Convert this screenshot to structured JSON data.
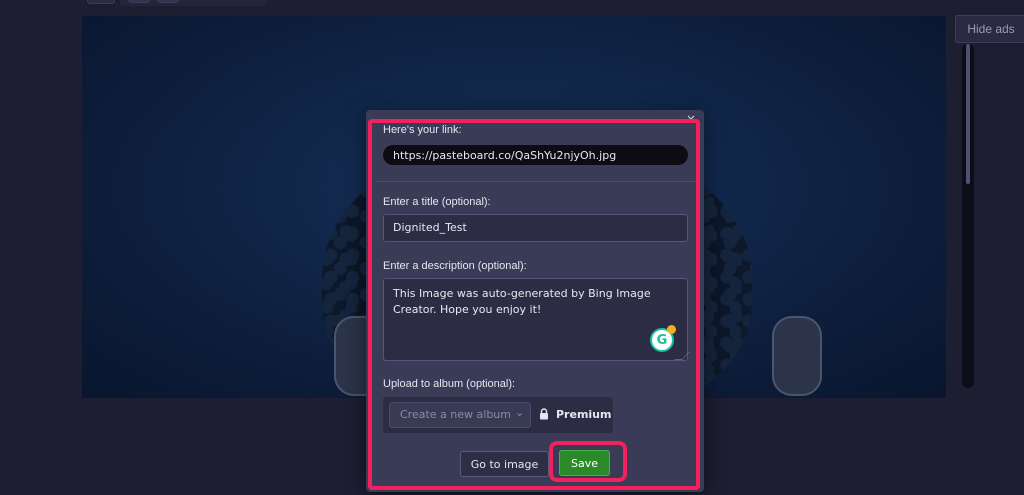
{
  "header": {
    "hide_ads_label": "Hide ads"
  },
  "dialog": {
    "link_label": "Here's your link:",
    "link_value": "https://pasteboard.co/QaShYu2njyOh.jpg",
    "title_label": "Enter a title (optional):",
    "title_value": "Dignited_Test",
    "description_label": "Enter a description (optional):",
    "description_value": "This Image was auto-generated by Bing Image Creator. Hope you enjoy it!",
    "album_label": "Upload to album (optional):",
    "album_select_value": "Create a new album",
    "premium_label": "Premium",
    "goto_button": "Go to image",
    "save_button": "Save",
    "close_glyph": "×"
  },
  "icons": {
    "grammarly": "grammarly-icon",
    "lock": "lock-icon",
    "chevron": "chevron-down-icon",
    "close": "close-icon"
  },
  "colors": {
    "highlight": "#f2215e",
    "save_green": "#2a8a2a",
    "background": "#1d1e32"
  }
}
